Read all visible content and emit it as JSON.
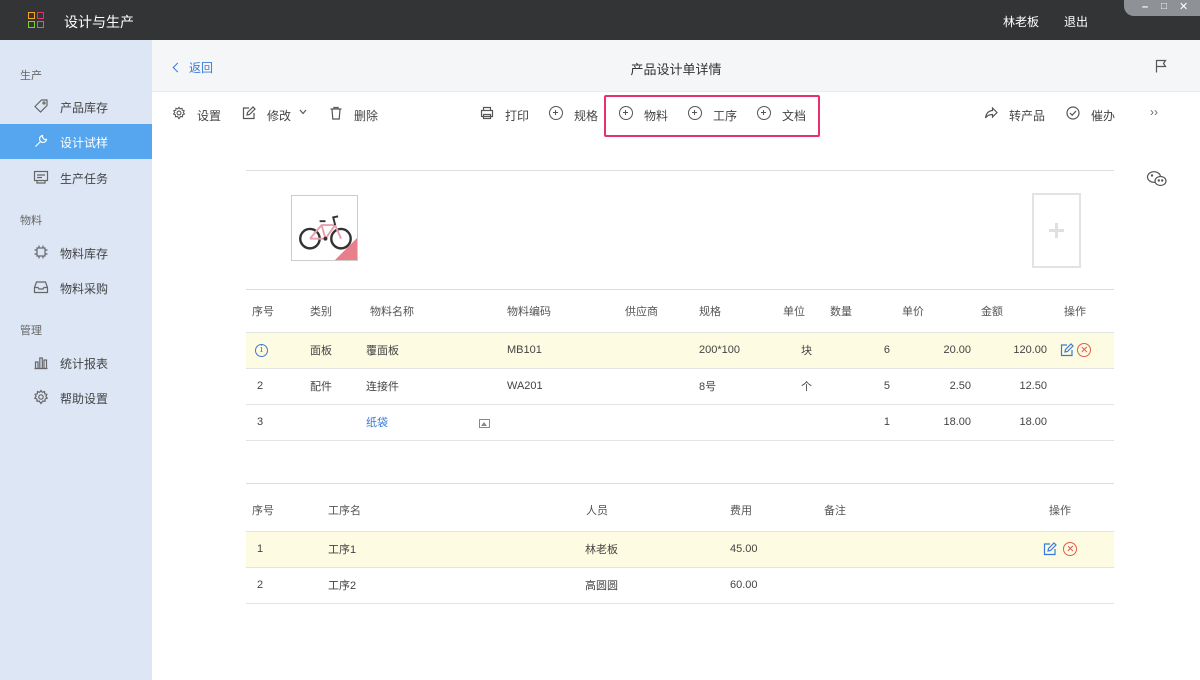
{
  "titlebar": {
    "title": "设计与生产",
    "user": "林老板",
    "logout": "退出",
    "logo_colors": [
      "#f5a623",
      "#e8306b",
      "#7ed321",
      "#4a90e2"
    ]
  },
  "sidebar": {
    "sections": [
      {
        "title": "生产",
        "items": [
          {
            "label": "产品库存",
            "icon": "tag-icon"
          },
          {
            "label": "设计试样",
            "icon": "wrench-icon",
            "active": true
          },
          {
            "label": "生产任务",
            "icon": "task-icon"
          }
        ]
      },
      {
        "title": "物料",
        "items": [
          {
            "label": "物料库存",
            "icon": "chip-icon"
          },
          {
            "label": "物料采购",
            "icon": "inbox-icon"
          }
        ]
      },
      {
        "title": "管理",
        "items": [
          {
            "label": "统计报表",
            "icon": "bar-chart-icon"
          },
          {
            "label": "帮助设置",
            "icon": "gear-icon"
          }
        ]
      }
    ]
  },
  "header": {
    "back": "返回",
    "title": "产品设计单详情"
  },
  "toolbar": {
    "settings": "设置",
    "edit": "修改",
    "delete": "删除",
    "print": "打印",
    "spec": "规格",
    "material": "物料",
    "process": "工序",
    "document": "文档",
    "to_product": "转产品",
    "urge": "催办",
    "more": "››"
  },
  "materials": {
    "headers": [
      "序号",
      "类别",
      "物料名称",
      "物料编码",
      "供应商",
      "规格",
      "单位",
      "数量",
      "单价",
      "金额",
      "操作"
    ],
    "rows": [
      {
        "no": "",
        "category": "面板",
        "name": "覆面板",
        "code": "MB101",
        "supplier": "",
        "spec": "200*100",
        "unit": "块",
        "qty": "6",
        "price": "20.00",
        "amount": "120.00"
      },
      {
        "no": "2",
        "category": "配件",
        "name": "连接件",
        "code": "WA201",
        "supplier": "",
        "spec": "8号",
        "unit": "个",
        "qty": "5",
        "price": "2.50",
        "amount": "12.50"
      },
      {
        "no": "3",
        "category": "",
        "name": "纸袋",
        "code": "",
        "supplier": "",
        "spec": "",
        "unit": "",
        "qty": "1",
        "price": "18.00",
        "amount": "18.00"
      }
    ]
  },
  "processes": {
    "headers": [
      "序号",
      "工序名",
      "人员",
      "费用",
      "备注",
      "操作"
    ],
    "rows": [
      {
        "no": "1",
        "name": "工序1",
        "person": "林老板",
        "cost": "45.00",
        "note": ""
      },
      {
        "no": "2",
        "name": "工序2",
        "person": "高圆圆",
        "cost": "60.00",
        "note": ""
      }
    ]
  }
}
